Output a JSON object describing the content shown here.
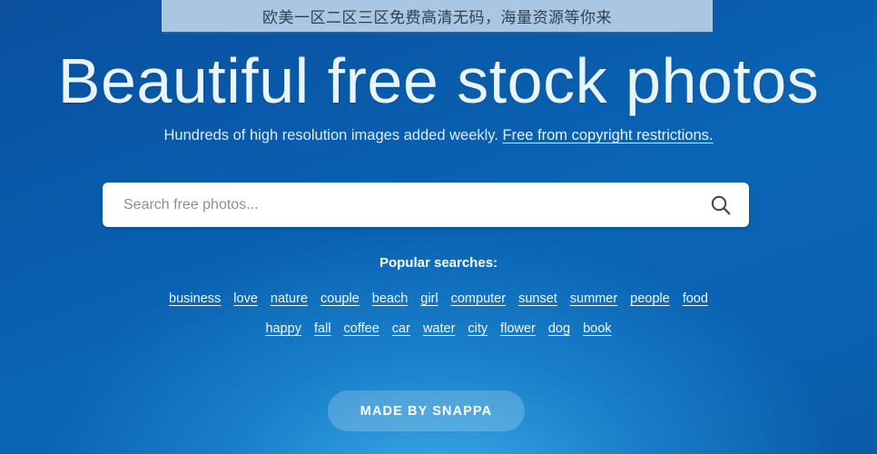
{
  "ad_banner": {
    "text": "欧美一区二区三区免费高清无码，海量资源等你来",
    "background": "#a9c6e3",
    "text_color": "#31404f"
  },
  "hero": {
    "title": "Beautiful free stock photos",
    "subtitle_text": "Hundreds of high resolution images added weekly. ",
    "subtitle_link": "Free from copyright restrictions."
  },
  "search": {
    "placeholder": "Search free photos...",
    "value": "",
    "icon": "search-icon"
  },
  "popular": {
    "label": "Popular searches:",
    "row1": [
      "business",
      "love",
      "nature",
      "couple",
      "beach",
      "girl",
      "computer",
      "sunset",
      "summer",
      "people",
      "food"
    ],
    "row2": [
      "happy",
      "fall",
      "coffee",
      "car",
      "water",
      "city",
      "flower",
      "dog",
      "book"
    ]
  },
  "footer": {
    "made_by_label": "MADE BY SNAPPA"
  },
  "colors": {
    "background_dark": "#0b4f9e",
    "background_mid": "#0a64b4",
    "glow": "#3cafeb",
    "heading": "#e9f4fb",
    "tag": "#f2f8fd"
  }
}
